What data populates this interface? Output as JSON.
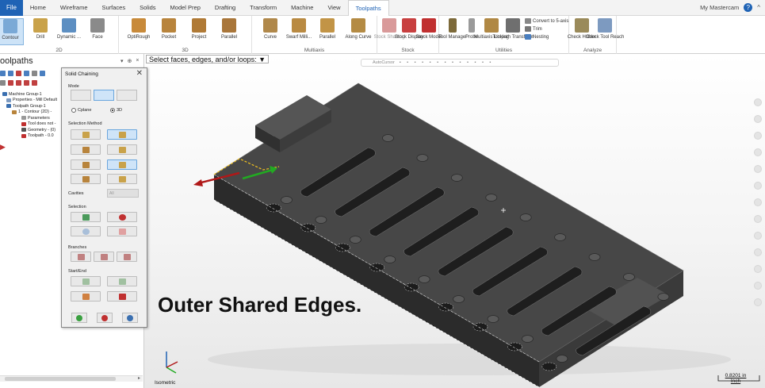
{
  "tabs": {
    "file": "File",
    "items": [
      "Home",
      "Wireframe",
      "Surfaces",
      "Solids",
      "Model Prep",
      "Drafting",
      "Transform",
      "Machine",
      "View",
      "Toolpaths"
    ],
    "active": "Toolpaths",
    "account": "My Mastercam",
    "help": "?",
    "collapse": "^"
  },
  "ribbon": {
    "groups": {
      "g2d": "2D",
      "g3d": "3D",
      "multiaxis": "Multiaxis",
      "stock": "Stock",
      "utilities": "Utilities",
      "analyze": "Analyze"
    },
    "buttons_2d": [
      "Contour",
      "Drill",
      "Dynamic ...",
      "Face"
    ],
    "buttons_3d": [
      "OptiRough",
      "Pocket",
      "Project",
      "Parallel"
    ],
    "buttons_multiaxis": [
      "Curve",
      "Swarf Milli...",
      "Parallel",
      "Along Curve"
    ],
    "buttons_stock": [
      "Stock Shading",
      "Stock Display",
      "Stock Model"
    ],
    "buttons_utilities": [
      "Tool Manager",
      "Probe",
      "Multiaxis Linking",
      "Toolpath Transform"
    ],
    "utility_small": [
      "Convert to 5-axis",
      "Trim",
      "Nesting"
    ],
    "buttons_analyze": [
      "Check Holder",
      "Check Tool Reach"
    ]
  },
  "leftpanel": {
    "title": "oolpaths",
    "controls": [
      "▾",
      "⊕",
      "×"
    ],
    "tree": [
      "Machine Group-1",
      "Properties - Mill Default",
      "Toolpath Group-1",
      "1 - Contour (2D) -",
      "Parameters",
      "Tool does not -",
      "Geometry - (0)",
      "Toolpath - 0.0"
    ]
  },
  "viewport": {
    "prompt": "Select faces, edges, and/or loops:",
    "prompt_arrow": "▼",
    "toolbar": "AutoCursor",
    "caption": "Outer Shared Edges.",
    "view_name": "Isometric",
    "scale_value": "0.8201 in",
    "scale_unit": "Inch"
  },
  "dialog": {
    "title": "Solid Chaining",
    "close": "✕",
    "mode_label": "Mode",
    "cplane": "Cplane",
    "three_d": "3D",
    "selection_method": "Selection Method",
    "cavities": "Cavities",
    "cavities_value": "All",
    "selection": "Selection",
    "branches": "Branches",
    "start_end": "Start/End"
  },
  "colors": {
    "accent": "#1f63b5",
    "model": "#3a3a3a",
    "selected_edge": "#f0c020",
    "axis_red": "#b01818",
    "axis_green": "#22aa22"
  }
}
